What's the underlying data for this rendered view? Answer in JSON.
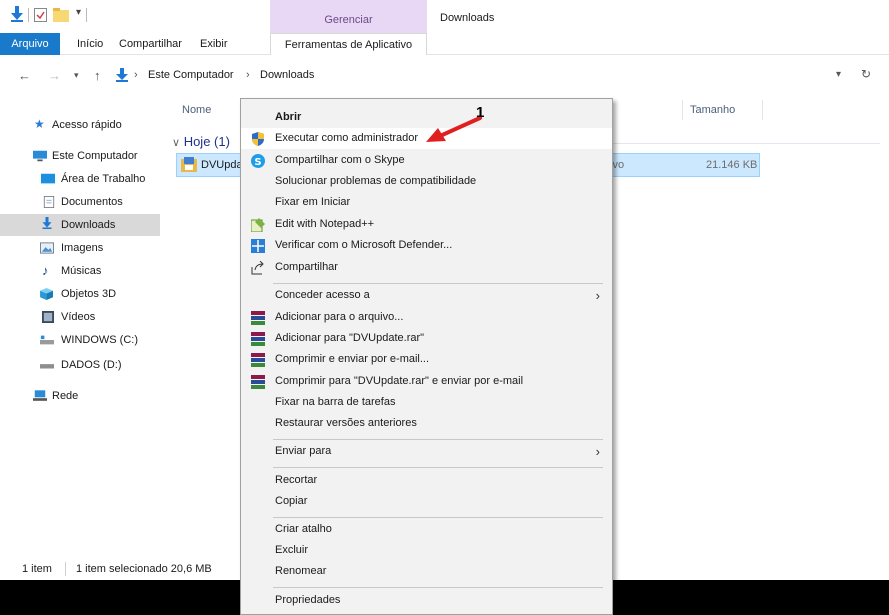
{
  "window": {
    "title": "Downloads",
    "manage_label": "Gerenciar"
  },
  "ribbon": {
    "tabs": [
      {
        "label": "Arquivo"
      },
      {
        "label": "Início"
      },
      {
        "label": "Compartilhar"
      },
      {
        "label": "Exibir"
      },
      {
        "label": "Ferramentas de Aplicativo"
      }
    ]
  },
  "address": {
    "crumbs": [
      "Este Computador",
      "Downloads"
    ]
  },
  "sidebar": {
    "items": [
      {
        "label": "Acesso rápido",
        "icon": "star-icon"
      },
      {
        "label": "Este Computador",
        "icon": "computer-icon"
      },
      {
        "label": "Área de Trabalho",
        "icon": "desktop-icon"
      },
      {
        "label": "Documentos",
        "icon": "document-icon"
      },
      {
        "label": "Downloads",
        "icon": "download-icon"
      },
      {
        "label": "Imagens",
        "icon": "image-icon"
      },
      {
        "label": "Músicas",
        "icon": "music-icon"
      },
      {
        "label": "Objetos 3D",
        "icon": "cube-icon"
      },
      {
        "label": "Vídeos",
        "icon": "video-icon"
      },
      {
        "label": "WINDOWS (C:)",
        "icon": "drive-icon"
      },
      {
        "label": "DADOS (D:)",
        "icon": "drive-icon"
      },
      {
        "label": "Rede",
        "icon": "network-icon"
      }
    ]
  },
  "columns": {
    "name": "Nome",
    "size": "Tamanho"
  },
  "group": {
    "label": "Hoje (1)"
  },
  "file": {
    "name": "DVUpda",
    "type": "ivo",
    "size": "21.146 KB"
  },
  "status": {
    "count": "1 item",
    "selection": "1 item selecionado  20,6 MB"
  },
  "context_menu": {
    "items": [
      {
        "label": "Abrir",
        "bold": true
      },
      {
        "label": "Executar como administrador",
        "icon": "shield-icon"
      },
      {
        "label": "Compartilhar com o Skype",
        "icon": "skype-icon"
      },
      {
        "label": "Solucionar problemas de compatibilidade"
      },
      {
        "label": "Fixar em Iniciar"
      },
      {
        "label": "Edit with Notepad++",
        "icon": "notepad-icon"
      },
      {
        "label": "Verificar com o Microsoft Defender...",
        "icon": "defender-icon"
      },
      {
        "label": "Compartilhar",
        "icon": "share-icon"
      },
      {
        "label": "Conceder acesso a",
        "submenu": true
      },
      {
        "label": "Adicionar para o arquivo...",
        "icon": "winrar-icon"
      },
      {
        "label": "Adicionar para \"DVUpdate.rar\"",
        "icon": "winrar-icon"
      },
      {
        "label": "Comprimir e enviar por e-mail...",
        "icon": "winrar-icon"
      },
      {
        "label": "Comprimir para \"DVUpdate.rar\" e enviar por e-mail",
        "icon": "winrar-icon"
      },
      {
        "label": "Fixar na barra de tarefas"
      },
      {
        "label": "Restaurar versões anteriores"
      },
      {
        "label": "Enviar para",
        "submenu": true
      },
      {
        "label": "Recortar"
      },
      {
        "label": "Copiar"
      },
      {
        "label": "Criar atalho"
      },
      {
        "label": "Excluir"
      },
      {
        "label": "Renomear"
      },
      {
        "label": "Propriedades"
      }
    ]
  },
  "annotation": {
    "number": "1",
    "color": "#e02020"
  }
}
